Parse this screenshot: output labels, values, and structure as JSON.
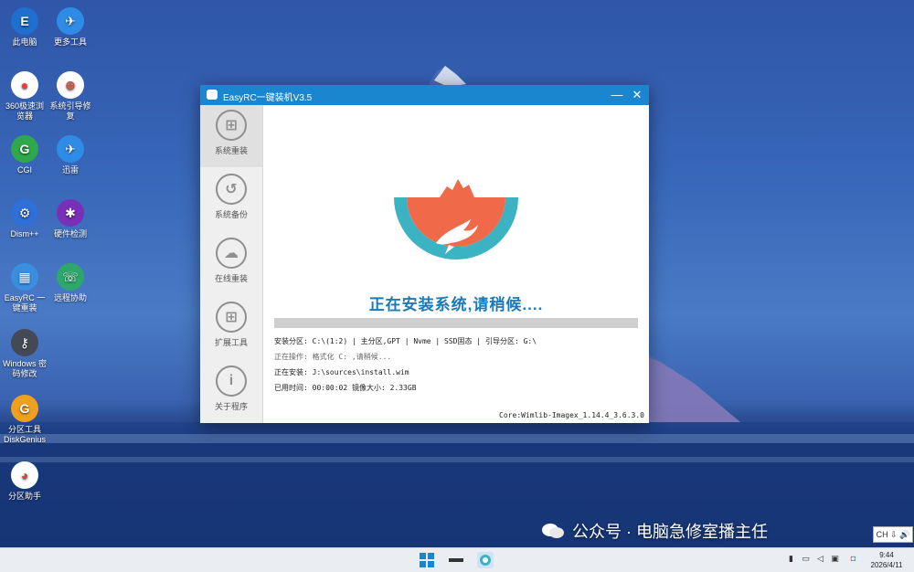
{
  "desktop": {
    "icons": [
      {
        "label": "此电脑",
        "color": "#1e6fd0",
        "glyph": "E"
      },
      {
        "label": "更多工具",
        "color": "#2f8ce6",
        "glyph": "✈"
      },
      {
        "label": "360极速浏览器",
        "color": "#ffffff",
        "glyph": "●"
      },
      {
        "label": "系统引导修复",
        "color": "#ffffff",
        "glyph": "⊕"
      },
      {
        "label": "CGI",
        "color": "#2ea84a",
        "glyph": "G"
      },
      {
        "label": "迅雷",
        "color": "#2f8ce6",
        "glyph": "✈"
      },
      {
        "label": "Dism++",
        "color": "#2f6fd8",
        "glyph": "⚙"
      },
      {
        "label": "硬件检测",
        "color": "#7a2fb8",
        "glyph": "✱"
      },
      {
        "label": "EasyRC 一键重装",
        "color": "#3a8ee0",
        "glyph": "▦"
      },
      {
        "label": "远程协助",
        "color": "#2ea86a",
        "glyph": "☏"
      },
      {
        "label": "Windows 密码修改",
        "color": "#444a55",
        "glyph": "⚷"
      },
      {
        "label": "分区工具DiskGenius",
        "color": "#f0a020",
        "glyph": "G"
      },
      {
        "label": "分区助手",
        "color": "#ffffff",
        "glyph": "◕"
      }
    ]
  },
  "window": {
    "title": "EasyRC一键装机V3.5",
    "minimize": "—",
    "close": "✕",
    "sidebar": [
      {
        "label": "系统重装",
        "icon": "windows-icon",
        "glyph": "⊞"
      },
      {
        "label": "系统备份",
        "icon": "backup-icon",
        "glyph": "↺"
      },
      {
        "label": "在线重装",
        "icon": "cloud-icon",
        "glyph": "☁"
      },
      {
        "label": "扩展工具",
        "icon": "tools-icon",
        "glyph": "⊞"
      },
      {
        "label": "关于程序",
        "icon": "info-icon",
        "glyph": "i"
      }
    ],
    "status": "正在安装系统,请稍候....",
    "progress": 0,
    "info": {
      "partition": "安装分区: C:\\(1:2) | 主分区,GPT | Nvme | SSD固态 | 引导分区: G:\\",
      "operation": "正在操作: 格式化 C: ,请稍候...",
      "installing": "正在安装: J:\\sources\\install.wim",
      "elapsed": "已用时间: 00:00:02  镜像大小: 2.33GB"
    },
    "core": "Core:Wimlib-Imagex_1.14.4_3.6.3.0"
  },
  "watermark": "公众号 · 电脑急修室播主任",
  "ime": "CH ⇩ 🔊",
  "taskbar": {
    "time": "9:44",
    "date": "2026/4/11"
  },
  "colors": {
    "accent": "#1b86d0",
    "logo_teal": "#3bb3c2",
    "logo_orange": "#f06a4a"
  }
}
